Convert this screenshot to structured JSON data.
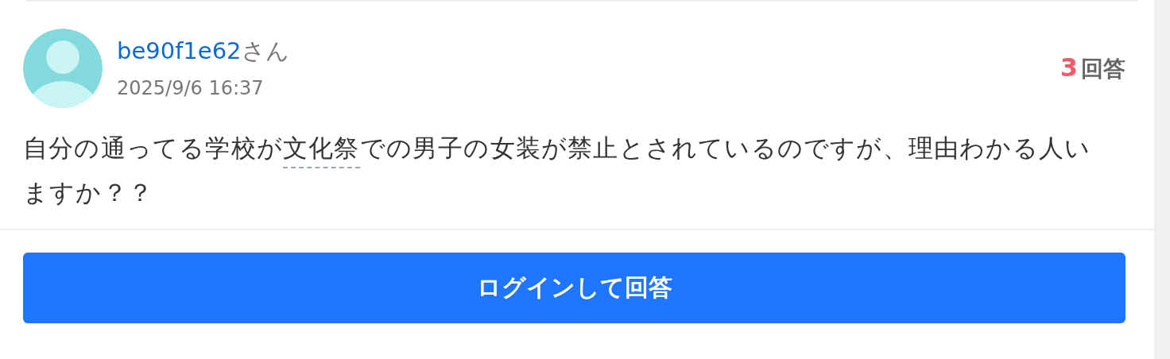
{
  "author": {
    "id": "be90f1e62",
    "suffix": "さん",
    "date": "2025/9/6 16:37"
  },
  "answer_count": {
    "number": "3",
    "label": "回答"
  },
  "question": {
    "before": "自分の通ってる学校が",
    "keyword": "文化祭",
    "after": "での男子の女装が禁止とされているのですが、理由わかる人いますか？？"
  },
  "login_button": {
    "label": "ログインして回答"
  }
}
